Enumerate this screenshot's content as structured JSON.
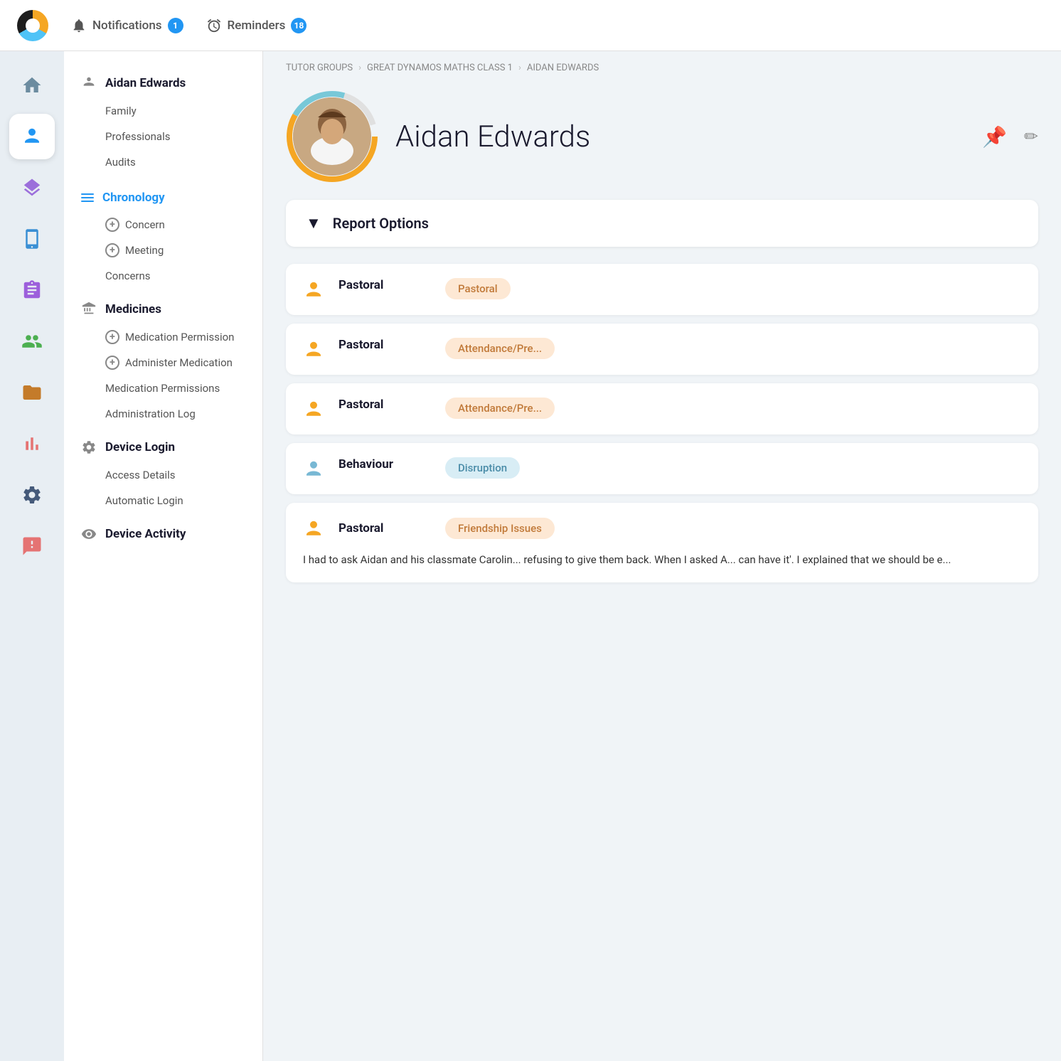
{
  "topbar": {
    "notifications_label": "Notifications",
    "notifications_count": "1",
    "reminders_label": "Reminders",
    "reminders_count": "18"
  },
  "breadcrumb": {
    "tutor_groups": "TUTOR GROUPS",
    "class": "GREAT DYNAMOS MATHS CLASS 1",
    "student": "AIDAN EDWARDS"
  },
  "profile": {
    "name": "Aidan Edwards",
    "pin_icon": "📌",
    "edit_icon": "✏"
  },
  "report_options": {
    "label": "Report Options"
  },
  "sidebar": {
    "student_name": "Aidan Edwards",
    "items": [
      {
        "label": "Family",
        "indent": true
      },
      {
        "label": "Professionals",
        "indent": true
      },
      {
        "label": "Audits",
        "indent": true
      }
    ],
    "chronology": "Chronology",
    "chron_items": [
      {
        "label": "Concern",
        "add": true
      },
      {
        "label": "Meeting",
        "add": true
      },
      {
        "label": "Concerns",
        "add": false
      }
    ],
    "medicines": "Medicines",
    "med_items": [
      {
        "label": "Medication Permission",
        "add": true
      },
      {
        "label": "Administer Medication",
        "add": true
      },
      {
        "label": "Medication Permissions",
        "add": false
      },
      {
        "label": "Administration Log",
        "add": false
      }
    ],
    "device_login": "Device Login",
    "device_items": [
      {
        "label": "Access Details"
      },
      {
        "label": "Automatic Login"
      }
    ],
    "device_activity": "Device Activity"
  },
  "entries": [
    {
      "category": "Pastoral",
      "badge_label": "Pastoral",
      "badge_type": "pastoral",
      "icon_type": "orange"
    },
    {
      "category": "Pastoral",
      "badge_label": "Attendance/Pre...",
      "badge_type": "pastoral",
      "icon_type": "orange"
    },
    {
      "category": "Pastoral",
      "badge_label": "Attendance/Pre...",
      "badge_type": "pastoral",
      "icon_type": "orange"
    },
    {
      "category": "Behaviour",
      "badge_label": "Disruption",
      "badge_type": "disruption",
      "icon_type": "blue"
    }
  ],
  "last_entry": {
    "category": "Pastoral",
    "badge_label": "Friendship Issues",
    "badge_type": "pastoral",
    "icon_type": "orange",
    "text": "I had to ask Aidan and his classmate Carolin... refusing to give them back. When I asked A... can have it'. I explained that we should be e..."
  },
  "nav_icons": [
    {
      "name": "home",
      "active": false
    },
    {
      "name": "person",
      "active": true
    },
    {
      "name": "layers",
      "active": false
    },
    {
      "name": "device",
      "active": false
    },
    {
      "name": "clipboard",
      "active": false
    },
    {
      "name": "group",
      "active": false
    },
    {
      "name": "folder",
      "active": false
    },
    {
      "name": "chart",
      "active": false
    },
    {
      "name": "settings",
      "active": false
    },
    {
      "name": "help",
      "active": false
    }
  ]
}
